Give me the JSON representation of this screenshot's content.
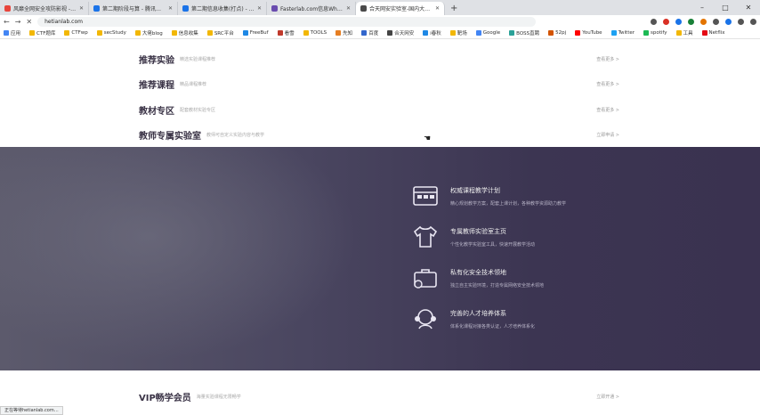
{
  "browser": {
    "tabs": [
      {
        "label": "风靡全网安全攻防影视 - 网络安…",
        "color": "#e8453c"
      },
      {
        "label": "第二期阶段与算 - 腾讯文档",
        "color": "#1a73e8"
      },
      {
        "label": "第二期信息收集(打点) - 腾讯文档",
        "color": "#1a73e8"
      },
      {
        "label": "Fasterlab.com信息Whoami…",
        "color": "#6a4caf"
      },
      {
        "label": "合天网安实验室-国内大型MOOC…",
        "color": "#4a4a4a"
      }
    ],
    "new_tab": "+",
    "url": "hetianlab.com",
    "bookmarks": [
      "应用",
      "CTF题库",
      "CTFwp",
      "secStudy",
      "大佬blog",
      "信息收集",
      "SRC平台",
      "FreeBuf",
      "看雪",
      "TOOLS",
      "先知",
      "百度",
      "合天网安",
      "i春秋",
      "靶场",
      "Google",
      "BOSS直聘",
      "52pj",
      "YouTube",
      "Twitter",
      "spotify",
      "工具",
      "Netflix"
    ]
  },
  "sections": [
    {
      "title": "推荐实验",
      "sub": "精选实验课程推荐",
      "more": "查看更多 >"
    },
    {
      "title": "推荐课程",
      "sub": "精品课程推荐",
      "more": "查看更多 >"
    },
    {
      "title": "教材专区",
      "sub": "配套教材实验专区",
      "more": "查看更多 >"
    },
    {
      "title": "教师专属实验室",
      "sub": "教师可自定义实验内容与教学",
      "more": "立即申请 >"
    }
  ],
  "features": [
    {
      "title": "权威课程教学计划",
      "desc": "精心规划教学方案，配套上课计划，各种教学资源助力教学"
    },
    {
      "title": "专属教师实验室主页",
      "desc": "个性化教学实验室工具，快速开展教学活动"
    },
    {
      "title": "私有化安全技术领地",
      "desc": "独立自主实验环境，打造专属网络安全技术领地"
    },
    {
      "title": "完善的人才培养体系",
      "desc": "体系化课程对接各类认证，人才培养体系化"
    }
  ],
  "vip": {
    "title": "VIP畅学会员",
    "sub": "海量实验课程无限畅学",
    "more": "立即开通 >"
  },
  "status_text": "正在等待hetianlab.com…"
}
